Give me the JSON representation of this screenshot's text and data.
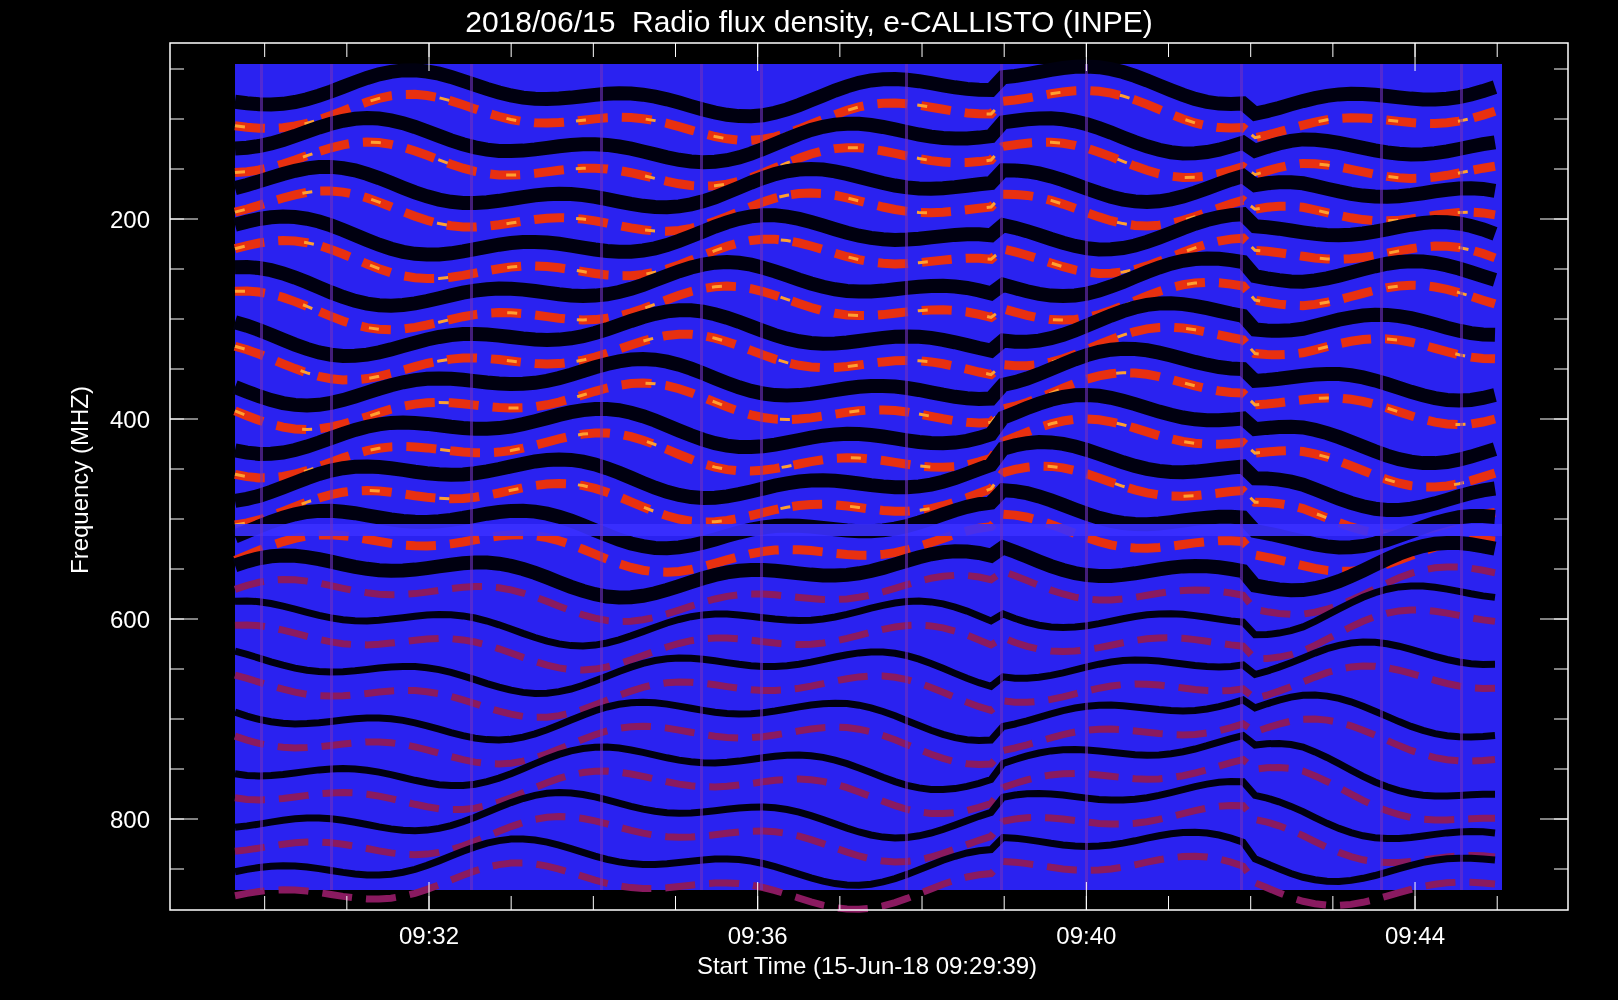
{
  "chart": {
    "title": "2018/06/15  Radio flux density, e-CALLISTO (INPE)",
    "ylabel": "Frequency (MHZ)",
    "xlabel": "Start Time (15-Jun-18 09:29:39)",
    "yticks": [
      "200",
      "400",
      "600",
      "800"
    ],
    "xticks": [
      "09:32",
      "09:36",
      "09:40",
      "09:44"
    ]
  }
}
